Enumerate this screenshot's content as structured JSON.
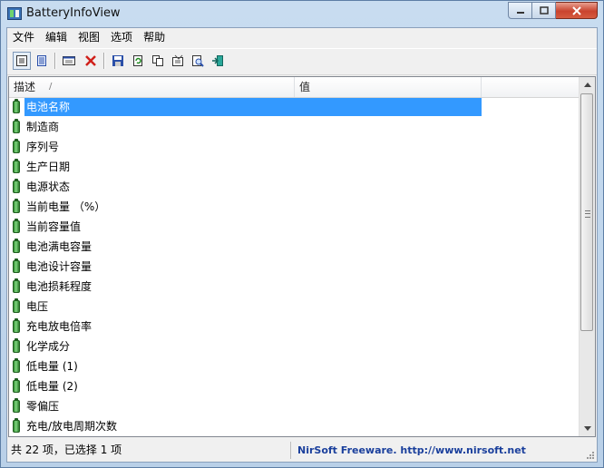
{
  "window": {
    "title": "BatteryInfoView"
  },
  "menu": [
    "文件",
    "编辑",
    "视图",
    "选项",
    "帮助"
  ],
  "toolbar": {
    "buttons": [
      {
        "name": "html-report-icon",
        "tooltip": ""
      },
      {
        "name": "properties-list-icon",
        "tooltip": ""
      },
      {
        "name": "grid-view-icon",
        "tooltip": ""
      },
      {
        "name": "delete-x-icon",
        "tooltip": ""
      },
      {
        "name": "save-disk-icon",
        "tooltip": ""
      },
      {
        "name": "refresh-icon",
        "tooltip": ""
      },
      {
        "name": "copy-icon",
        "tooltip": ""
      },
      {
        "name": "properties-icon",
        "tooltip": ""
      },
      {
        "name": "find-icon",
        "tooltip": ""
      },
      {
        "name": "exit-icon",
        "tooltip": ""
      }
    ]
  },
  "list": {
    "columns": [
      "描述",
      "值"
    ],
    "sort_indicator": "/",
    "rows": [
      "电池名称",
      "制造商",
      "序列号",
      "生产日期",
      "电源状态",
      "当前电量 （%）",
      "当前容量值",
      "电池满电容量",
      "电池设计容量",
      "电池损耗程度",
      "电压",
      "充电放电倍率",
      "化学成分",
      "低电量 (1)",
      "低电量 (2)",
      "零偏压",
      "充电/放电周期次数"
    ],
    "selected_index": 0
  },
  "status": {
    "summary": "共 22 项，已选择 1 项",
    "credit": "NirSoft Freeware.  http://www.nirsoft.net"
  },
  "colors": {
    "selection": "#3399ff",
    "credit": "#1a3f9c",
    "battery": "#2f8a2f"
  }
}
